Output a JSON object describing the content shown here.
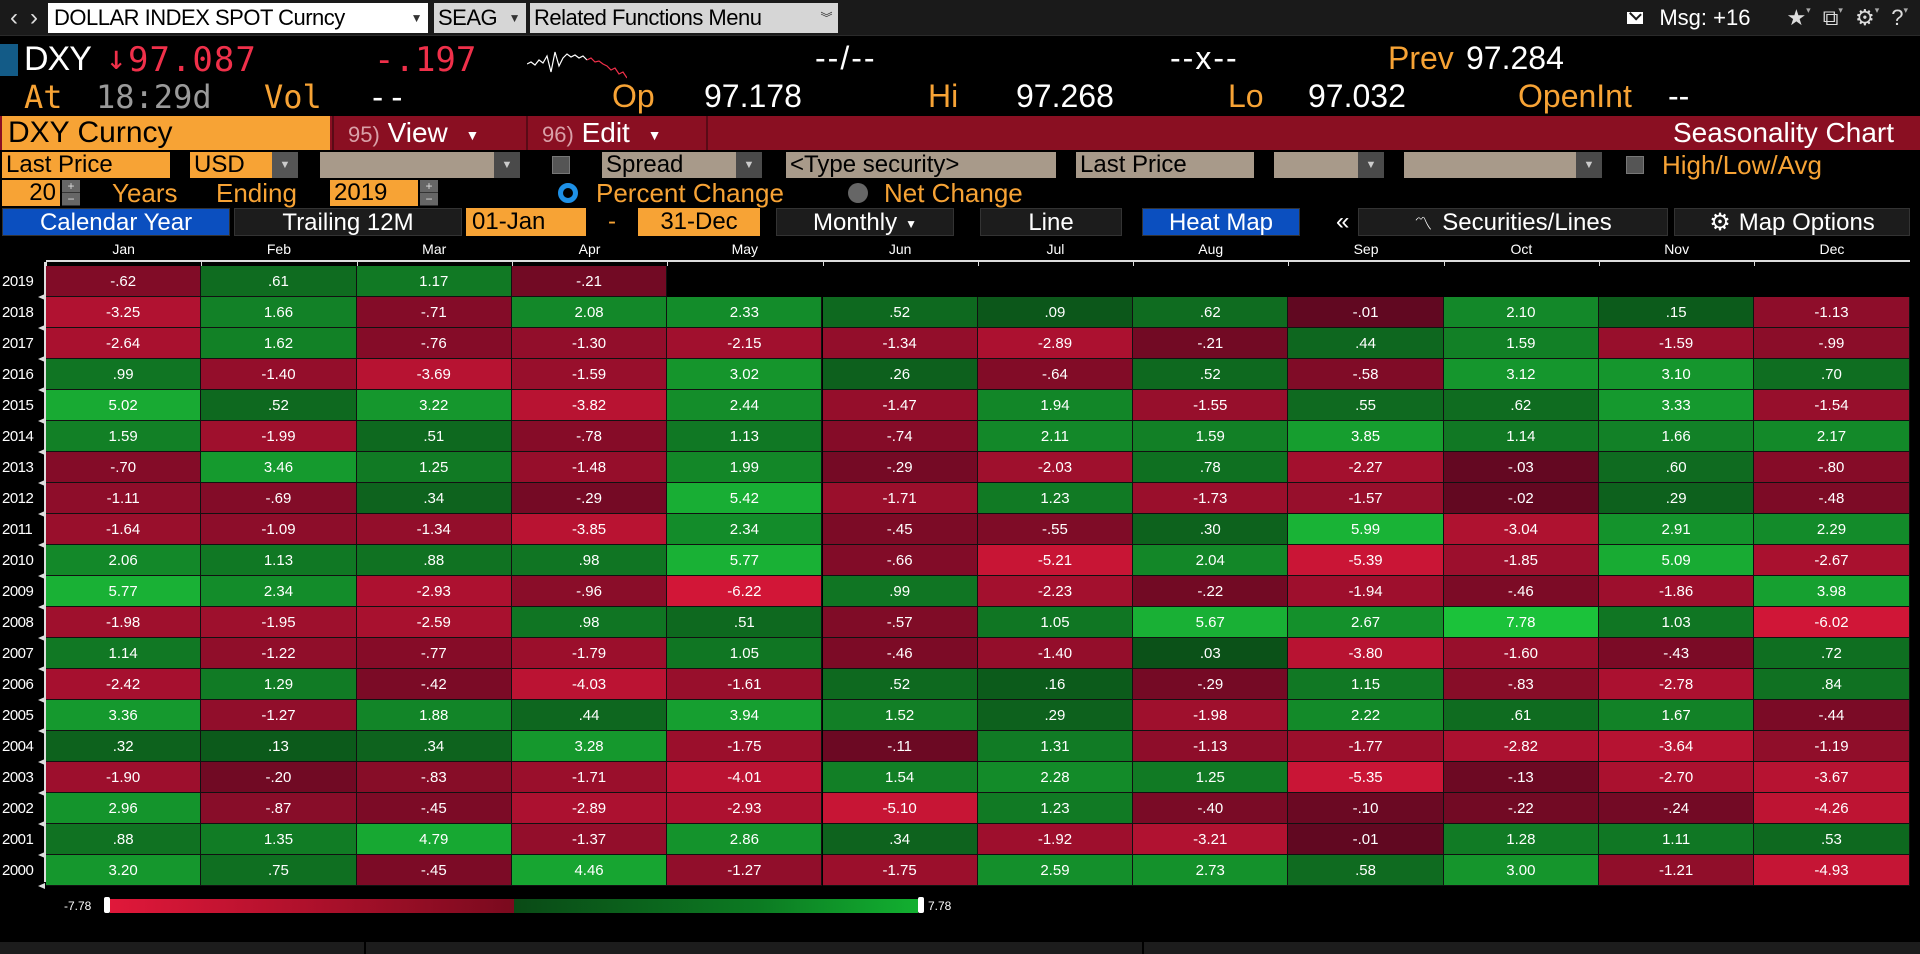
{
  "toolbar": {
    "security_input": "DOLLAR INDEX SPOT Curncy",
    "function_code": "SEAG",
    "related_menu": "Related Functions Menu",
    "msg_label": "Msg: +16"
  },
  "quote": {
    "ticker": "DXY",
    "last": "97.087",
    "direction": "down",
    "change": "-.197",
    "bid_ask": "--/--",
    "size": "--x--",
    "prev_label": "Prev",
    "prev": "97.284",
    "at_label": "At",
    "time": "18:29d",
    "vol_label": "Vol",
    "vol": "--",
    "open_label": "Op",
    "open": "97.178",
    "high_label": "Hi",
    "high": "97.268",
    "low_label": "Lo",
    "low": "97.032",
    "oi_label": "OpenInt",
    "oi": "--"
  },
  "function_bar": {
    "security": "DXY Curncy",
    "view_num": "95)",
    "view_label": "View",
    "edit_num": "96)",
    "edit_label": "Edit",
    "title": "Seasonality Chart"
  },
  "settings": {
    "field": "Last Price",
    "currency": "USD",
    "spread": "Spread",
    "type_security_placeholder": "<Type security>",
    "field2": "Last Price",
    "high_low_avg": "High/Low/Avg",
    "years": "20",
    "years_label": "Years",
    "ending_label": "Ending",
    "ending_year": "2019",
    "percent_change": "Percent Change",
    "net_change": "Net Change",
    "mode": "percent"
  },
  "tabs": {
    "calendar_year": "Calendar Year",
    "trailing": "Trailing 12M",
    "start_date": "01-Jan",
    "dash": "-",
    "end_date": "31-Dec",
    "period": "Monthly",
    "line": "Line",
    "heat_map": "Heat Map",
    "collapse": "«",
    "securities_lines": "Securities/Lines",
    "map_options": "Map Options"
  },
  "chart_data": {
    "type": "heatmap",
    "title": "Seasonality Chart - DXY Curncy Monthly Percent Change",
    "columns": [
      "Jan",
      "Feb",
      "Mar",
      "Apr",
      "May",
      "Jun",
      "Jul",
      "Aug",
      "Sep",
      "Oct",
      "Nov",
      "Dec"
    ],
    "rows": [
      "2019",
      "2018",
      "2017",
      "2016",
      "2015",
      "2014",
      "2013",
      "2012",
      "2011",
      "2010",
      "2009",
      "2008",
      "2007",
      "2006",
      "2005",
      "2004",
      "2003",
      "2002",
      "2001",
      "2000"
    ],
    "values": [
      [
        "-.62",
        ".61",
        "1.17",
        "-.21",
        null,
        null,
        null,
        null,
        null,
        null,
        null,
        null
      ],
      [
        "-3.25",
        "1.66",
        "-.71",
        "2.08",
        "2.33",
        ".52",
        ".09",
        ".62",
        "-.01",
        "2.10",
        ".15",
        "-1.13"
      ],
      [
        "-2.64",
        "1.62",
        "-.76",
        "-1.30",
        "-2.15",
        "-1.34",
        "-2.89",
        "-.21",
        ".44",
        "1.59",
        "-1.59",
        "-.99"
      ],
      [
        ".99",
        "-1.40",
        "-3.69",
        "-1.59",
        "3.02",
        ".26",
        "-.64",
        ".52",
        "-.58",
        "3.12",
        "3.10",
        ".70"
      ],
      [
        "5.02",
        ".52",
        "3.22",
        "-3.82",
        "2.44",
        "-1.47",
        "1.94",
        "-1.55",
        ".55",
        ".62",
        "3.33",
        "-1.54"
      ],
      [
        "1.59",
        "-1.99",
        ".51",
        "-.78",
        "1.13",
        "-.74",
        "2.11",
        "1.59",
        "3.85",
        "1.14",
        "1.66",
        "2.17"
      ],
      [
        "-.70",
        "3.46",
        "1.25",
        "-1.48",
        "1.99",
        "-.29",
        "-2.03",
        ".78",
        "-2.27",
        "-.03",
        ".60",
        "-.80"
      ],
      [
        "-1.11",
        "-.69",
        ".34",
        "-.29",
        "5.42",
        "-1.71",
        "1.23",
        "-1.73",
        "-1.57",
        "-.02",
        ".29",
        "-.48"
      ],
      [
        "-1.64",
        "-1.09",
        "-1.34",
        "-3.85",
        "2.34",
        "-.45",
        "-.55",
        ".30",
        "5.99",
        "-3.04",
        "2.91",
        "2.29"
      ],
      [
        "2.06",
        "1.13",
        ".88",
        ".98",
        "5.77",
        "-.66",
        "-5.21",
        "2.04",
        "-5.39",
        "-1.85",
        "5.09",
        "-2.67"
      ],
      [
        "5.77",
        "2.34",
        "-2.93",
        "-.96",
        "-6.22",
        ".99",
        "-2.23",
        "-.22",
        "-1.94",
        "-.46",
        "-1.86",
        "3.98"
      ],
      [
        "-1.98",
        "-1.95",
        "-2.59",
        ".98",
        ".51",
        "-.57",
        "1.05",
        "5.67",
        "2.67",
        "7.78",
        "1.03",
        "-6.02"
      ],
      [
        "1.14",
        "-1.22",
        "-.77",
        "-1.79",
        "1.05",
        "-.46",
        "-1.40",
        ".03",
        "-3.80",
        "-1.60",
        "-.43",
        ".72"
      ],
      [
        "-2.42",
        "1.29",
        "-.42",
        "-4.03",
        "-1.61",
        ".52",
        ".16",
        "-.29",
        "1.15",
        "-.83",
        "-2.78",
        ".84"
      ],
      [
        "3.36",
        "-1.27",
        "1.88",
        ".44",
        "3.94",
        "1.52",
        ".29",
        "-1.98",
        "2.22",
        ".61",
        "1.67",
        "-.44"
      ],
      [
        ".32",
        ".13",
        ".34",
        "3.28",
        "-1.75",
        "-.11",
        "1.31",
        "-1.13",
        "-1.77",
        "-2.82",
        "-3.64",
        "-1.19"
      ],
      [
        "-1.90",
        "-.20",
        "-.83",
        "-1.71",
        "-4.01",
        "1.54",
        "2.28",
        "1.25",
        "-5.35",
        "-.13",
        "-2.70",
        "-3.67"
      ],
      [
        "2.96",
        "-.87",
        "-.45",
        "-2.89",
        "-2.93",
        "-5.10",
        "1.23",
        "-.40",
        "-.10",
        "-.22",
        "-.24",
        "-4.26"
      ],
      [
        ".88",
        "1.35",
        "4.79",
        "-1.37",
        "2.86",
        ".34",
        "-1.92",
        "-3.21",
        "-.01",
        "1.28",
        "1.11",
        ".53"
      ],
      [
        "3.20",
        ".75",
        "-.45",
        "4.46",
        "-1.27",
        "-1.75",
        "2.59",
        "2.73",
        ".58",
        "3.00",
        "-1.21",
        "-4.93"
      ]
    ],
    "color_scale": {
      "min": -7.78,
      "max": 7.78,
      "min_label": "-7.78",
      "max_label": "7.78",
      "neg_strong": "#e0183a",
      "neg_weak": "#5c0720",
      "pos_weak": "#0a4a16",
      "pos_strong": "#1bc23a"
    },
    "legend": "bottom"
  }
}
